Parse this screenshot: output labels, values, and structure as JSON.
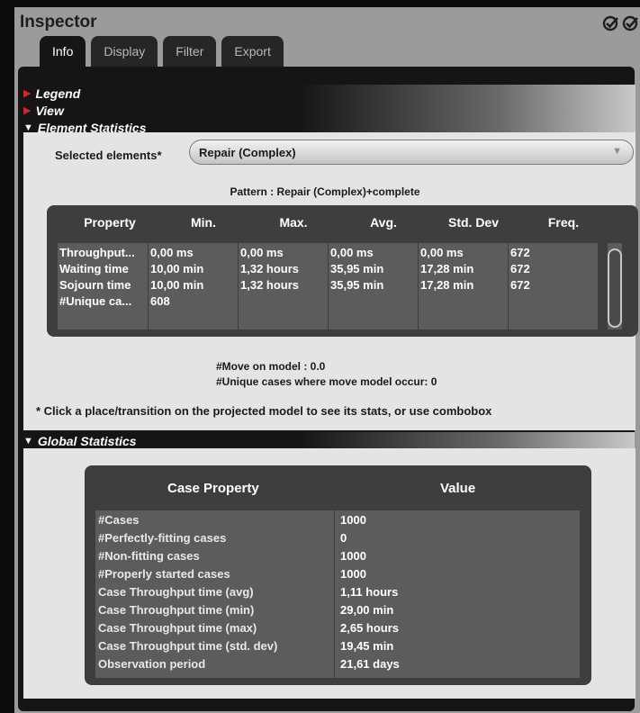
{
  "window": {
    "title": "Inspector"
  },
  "tabs": [
    "Info",
    "Display",
    "Filter",
    "Export"
  ],
  "sections": {
    "legend": "Legend",
    "view": "View",
    "element_statistics": "Element Statistics",
    "global_statistics": "Global Statistics"
  },
  "element_stats": {
    "selected_label": "Selected elements*",
    "selected_value": "Repair (Complex)",
    "pattern": "Pattern : Repair (Complex)+complete",
    "columns": [
      "Property",
      "Min.",
      "Max.",
      "Avg.",
      "Std. Dev",
      "Freq."
    ],
    "rows": [
      [
        "Throughput...",
        "0,00 ms",
        "0,00 ms",
        "0,00 ms",
        "0,00 ms",
        "672"
      ],
      [
        "Waiting time",
        "10,00 min",
        "1,32 hours",
        "35,95 min",
        "17,28 min",
        "672"
      ],
      [
        "Sojourn time",
        "10,00 min",
        "1,32 hours",
        "35,95 min",
        "17,28 min",
        "672"
      ],
      [
        "#Unique ca...",
        "608",
        "",
        "",
        "",
        ""
      ]
    ],
    "move_on_model": "#Move on model : 0.0",
    "unique_cases_move": "#Unique cases where move model occur: 0",
    "hint": "* Click a place/transition on the projected model to see its stats, or use combobox"
  },
  "global_stats": {
    "columns": [
      "Case Property",
      "Value"
    ],
    "rows": [
      [
        "#Cases",
        "1000"
      ],
      [
        "#Perfectly-fitting cases",
        "0"
      ],
      [
        "#Non-fitting cases",
        "1000"
      ],
      [
        "#Properly started cases",
        "1000"
      ],
      [
        "Case Throughput time (avg)",
        "1,11 hours"
      ],
      [
        "Case Throughput time (min)",
        "29,00 min"
      ],
      [
        "Case Throughput time (max)",
        "2,65 hours"
      ],
      [
        "Case Throughput time (std. dev)",
        "19,45 min"
      ],
      [
        "Observation period",
        "21,61 days"
      ]
    ]
  },
  "colors": {
    "accent_red": "#e02222",
    "panel_dark": "#151515",
    "table_bg": "#5c5c5c",
    "content_bg": "#e4e4e4"
  },
  "icons": [
    "expand-arrow-icon",
    "collapse-arrow-icon",
    "check-badge-icon",
    "dropdown-arrow-icon"
  ]
}
